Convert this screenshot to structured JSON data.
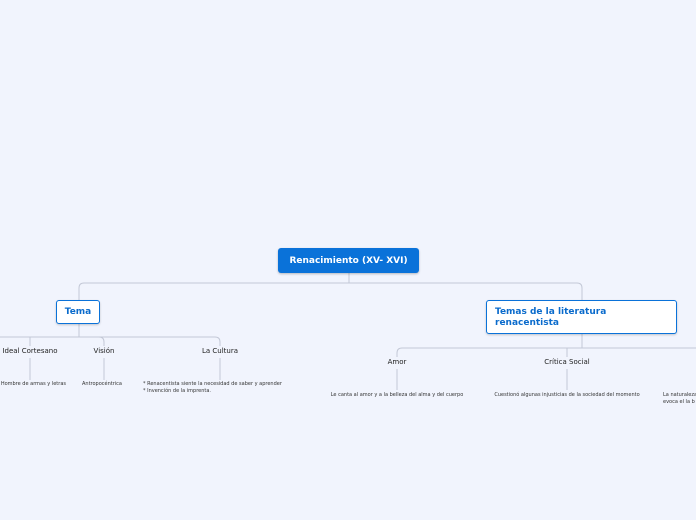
{
  "root": {
    "label": "Renacimiento (XV- XVI)"
  },
  "branches": [
    {
      "label": "Tema",
      "children": [
        {
          "label": "Ideal Cortesano",
          "detail": "Hombre de armas y letras"
        },
        {
          "label": "Visión",
          "detail": "Antropocéntrica"
        },
        {
          "label": "La Cultura",
          "detail_lines": [
            "* Renacentista siente la necesidad de saber y aprender",
            "* Invención de la imprenta."
          ]
        }
      ]
    },
    {
      "label": "Temas de la literatura renacentista",
      "children": [
        {
          "label": "Amor",
          "detail": "Le canta al amor y a la belleza del alma y del cuerpo"
        },
        {
          "label": "Crítica Social",
          "detail": "Cuestionó algunas injusticias de la sociedad del momento"
        },
        {
          "label": "",
          "detail_lines": [
            "La naturaleza",
            "evoca el la b"
          ]
        }
      ]
    }
  ],
  "colors": {
    "background": "#f1f4fd",
    "accent": "#0a72d9",
    "connector": "#c3c8d6"
  }
}
